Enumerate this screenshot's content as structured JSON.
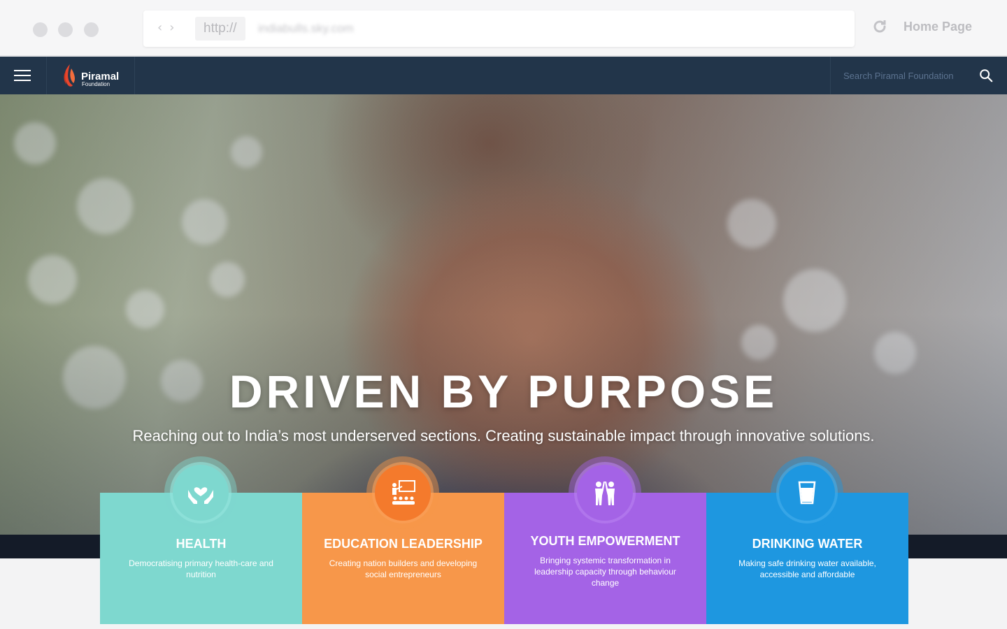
{
  "browser": {
    "url_protocol": "http://",
    "url_domain": "indiabulls.sky.com",
    "home_label": "Home Page"
  },
  "header": {
    "logo_name": "Piramal",
    "logo_sub": "Foundation",
    "search_placeholder": "Search Piramal Foundation"
  },
  "hero": {
    "title": "DRIVEN BY PURPOSE",
    "subtitle": "Reaching out to India’s most underserved sections. Creating sustainable impact through innovative solutions."
  },
  "cards": [
    {
      "title": "HEALTH",
      "description": "Democratising primary health-care and nutrition",
      "color": "#7ed8cf",
      "icon": "heart-hands-icon"
    },
    {
      "title": "EDUCATION LEADERSHIP",
      "description": "Creating nation builders and developing social entrepreneurs",
      "color": "#f7974a",
      "icon": "classroom-icon"
    },
    {
      "title": "YOUTH EMPOWERMENT",
      "description": "Bringing systemic transformation in leadership capacity through behaviour change",
      "color": "#a463e6",
      "icon": "youth-high-five-icon"
    },
    {
      "title": "DRINKING WATER",
      "description": "Making safe drinking water available, accessible and affordable",
      "color": "#1e97e0",
      "icon": "water-glass-icon"
    }
  ],
  "colors": {
    "header_bg": "#22354a",
    "logo_accent": "#e8452c",
    "footer_band": "#141b28"
  }
}
